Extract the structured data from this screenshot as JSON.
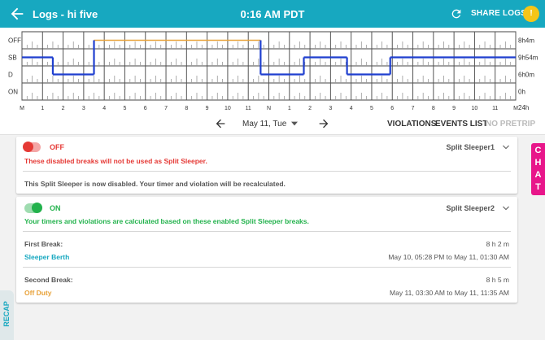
{
  "header": {
    "title": "Logs - hi five",
    "clock": "0:16 AM PDT",
    "share_label": "SHARE LOGS",
    "alert_symbol": "!",
    "bg_color": "#17a8c0"
  },
  "graph": {
    "rows": [
      "OFF",
      "SB",
      "D",
      "ON"
    ],
    "hour_labels": [
      "M",
      "1",
      "2",
      "3",
      "4",
      "5",
      "6",
      "7",
      "8",
      "9",
      "10",
      "11",
      "N",
      "1",
      "2",
      "3",
      "4",
      "5",
      "6",
      "7",
      "8",
      "9",
      "10",
      "11",
      "M"
    ],
    "totals": [
      "8h4m",
      "9h54m",
      "6h0m",
      "0h",
      "24h"
    ],
    "off_color": "#e8a23a",
    "active_color": "#1f3fcf",
    "segments": [
      {
        "status": "SB",
        "from": 0.0,
        "to": 1.5
      },
      {
        "status": "D",
        "from": 1.5,
        "to": 3.5
      },
      {
        "status": "OFF",
        "from": 3.5,
        "to": 11.6
      },
      {
        "status": "D",
        "from": 11.6,
        "to": 13.7
      },
      {
        "status": "SB",
        "from": 13.7,
        "to": 15.8
      },
      {
        "status": "D",
        "from": 15.8,
        "to": 17.9
      },
      {
        "status": "SB",
        "from": 17.9,
        "to": 24.0
      }
    ]
  },
  "nav": {
    "date": "May 11, Tue",
    "violations": "VIOLATIONS",
    "events": "EVENTS LIST",
    "pretrip": "NO PRETRIP"
  },
  "split1": {
    "state": "OFF",
    "name": "Split Sleeper1",
    "warning": "These disabled breaks will not be used as Split Sleeper.",
    "info": "This Split Sleeper is now disabled. Your timer and violation will be recalculated.",
    "state_color": "#e53935"
  },
  "split2": {
    "state": "ON",
    "name": "Split Sleeper2",
    "message": "Your timers and violations are calculated based on these enabled Split Sleeper breaks.",
    "first_label": "First Break:",
    "first_duration": "8 h 2 m",
    "first_status": "Sleeper Berth",
    "first_range": "May 10, 05:28 PM to May 11, 01:30 AM",
    "second_label": "Second Break:",
    "second_duration": "8 h 5 m",
    "second_status": "Off Duty",
    "second_range": "May 11, 03:30 AM to May 11, 11:35 AM",
    "state_color": "#22b24c",
    "first_status_color": "#17a8c0",
    "second_status_color": "#e8a23a"
  },
  "side": {
    "chat": "CHAT",
    "recap": "RECAP"
  }
}
